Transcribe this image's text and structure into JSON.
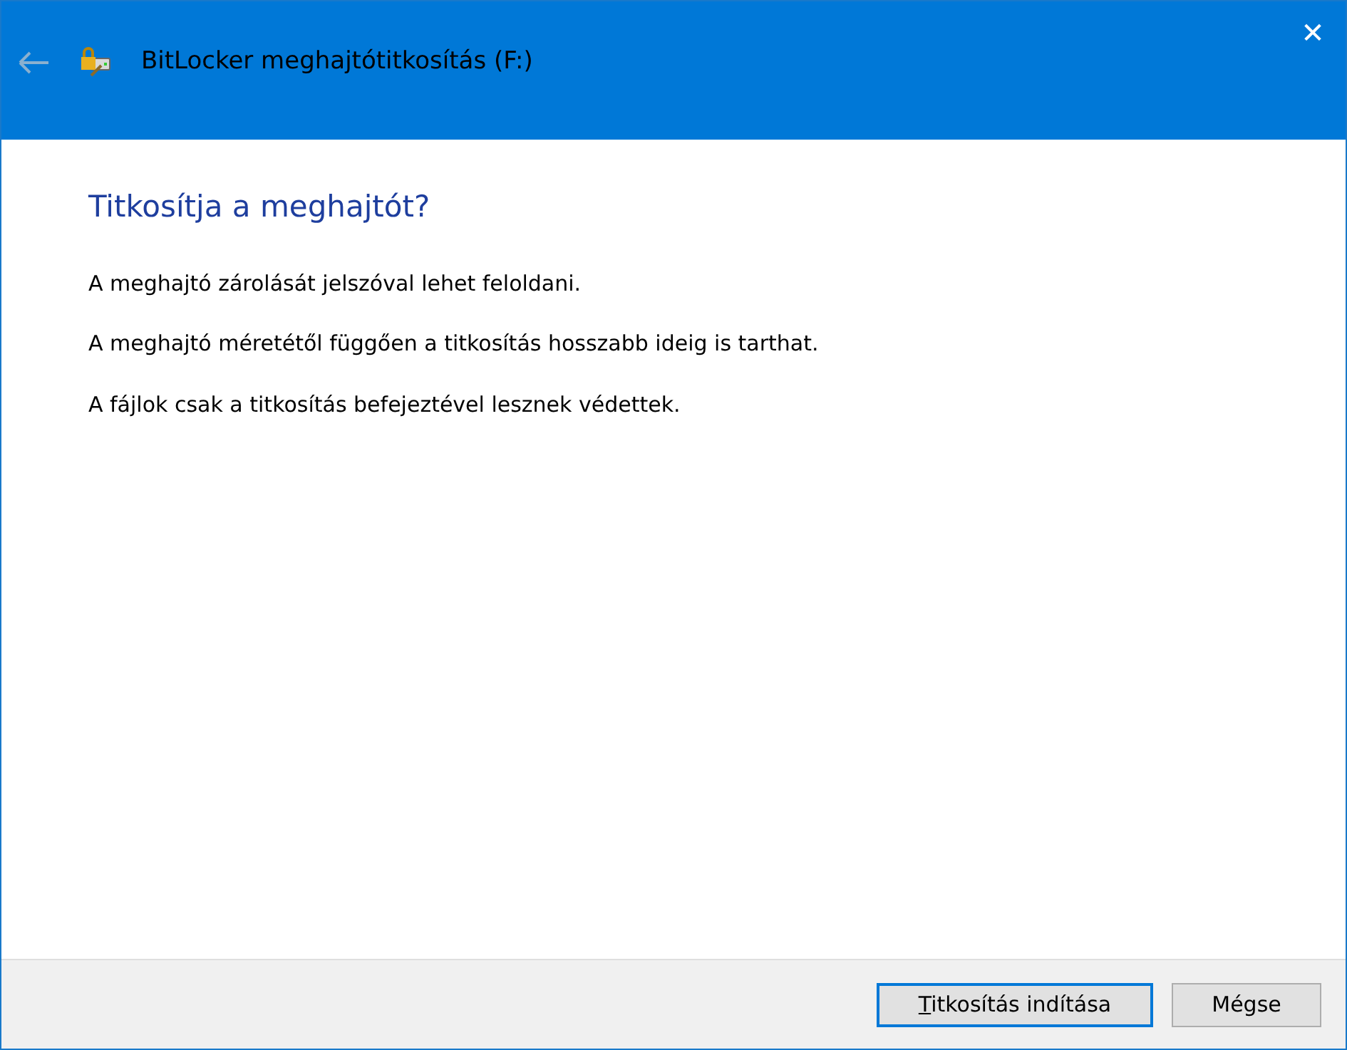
{
  "window": {
    "title": "BitLocker meghajtótitkosítás (F:)",
    "close": "✕"
  },
  "heading": "Titkosítja a meghajtót?",
  "paragraphs": [
    "A meghajtó zárolását jelszóval lehet feloldani.",
    "A meghajtó méretétől függően a titkosítás hosszabb ideig is tarthat.",
    "A fájlok csak a titkosítás befejeztével lesznek védettek."
  ],
  "buttons": [
    {
      "label": "Titkosítás indítása",
      "default": true,
      "access_key": true
    },
    {
      "label": "Mégse",
      "default": false,
      "access_key": false
    }
  ]
}
